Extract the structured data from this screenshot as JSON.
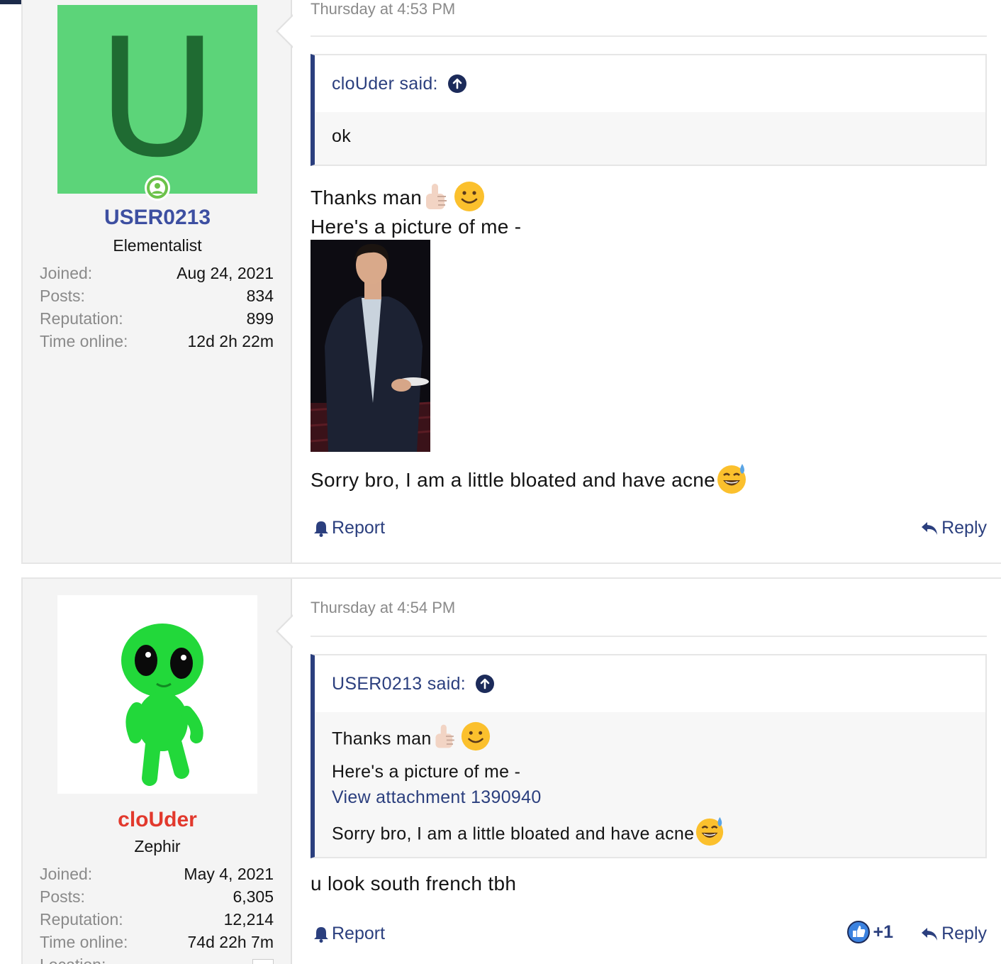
{
  "posts": [
    {
      "user": {
        "avatar_letter": "U",
        "avatar_color": "#5cd479",
        "username": "USER0213",
        "username_color": "#3d4fa1",
        "title": "Elementalist",
        "stats": [
          {
            "label": "Joined:",
            "value": "Aug 24, 2021"
          },
          {
            "label": "Posts:",
            "value": "834"
          },
          {
            "label": "Reputation:",
            "value": "899"
          },
          {
            "label": "Time online:",
            "value": "12d 2h 22m"
          }
        ]
      },
      "datetime": "Thursday at 4:53 PM",
      "quote": {
        "author": "cloUder said:",
        "body": "ok"
      },
      "lines": [
        "Thanks man",
        "Here's a picture of me -",
        "Sorry bro, I am a little bloated and have acne"
      ],
      "actions": {
        "report": "Report",
        "reply": "Reply"
      }
    },
    {
      "user": {
        "username": "cloUder",
        "username_color": "#e2392d",
        "title": "Zephir",
        "stats": [
          {
            "label": "Joined:",
            "value": "May 4, 2021"
          },
          {
            "label": "Posts:",
            "value": "6,305"
          },
          {
            "label": "Reputation:",
            "value": "12,214"
          },
          {
            "label": "Time online:",
            "value": "74d 22h 7m"
          },
          {
            "label": "Location:",
            "value": ""
          }
        ]
      },
      "datetime": "Thursday at 4:54 PM",
      "quote": {
        "author": "USER0213 said:",
        "lines": [
          "Thanks man",
          "Here's a picture of me -",
          "View attachment 1390940",
          "Sorry bro, I am a little bloated and have acne"
        ]
      },
      "lines": [
        "u look south french tbh"
      ],
      "actions": {
        "report": "Report",
        "like_count": "+1",
        "reply": "Reply"
      }
    }
  ],
  "icons": [
    "bell-icon",
    "reply-icon",
    "arrow-up-circle-icon",
    "online-user-icon",
    "thumbs-up-emoji",
    "smile-emoji",
    "sweat-smile-emoji",
    "like-icon"
  ]
}
